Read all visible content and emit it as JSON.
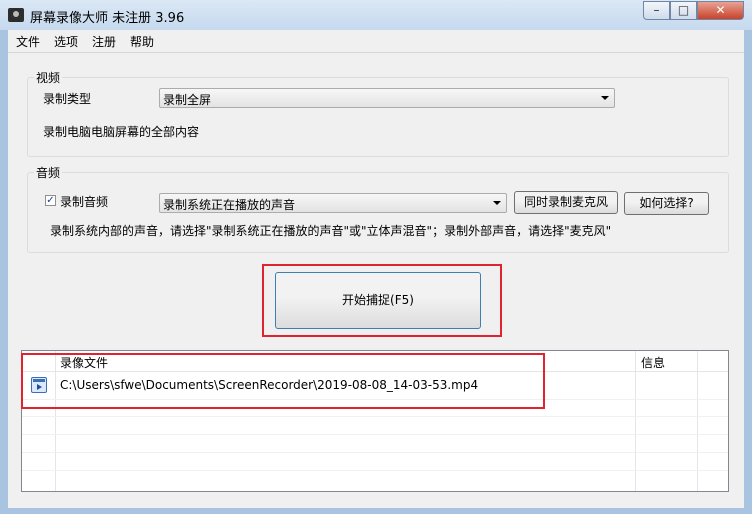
{
  "window": {
    "title": "屏幕录像大师 未注册 3.96"
  },
  "menu": [
    "文件",
    "选项",
    "注册",
    "帮助"
  ],
  "video": {
    "group_title": "视频",
    "record_type_label": "录制类型",
    "record_type_value": "录制全屏",
    "description": "录制电脑电脑屏幕的全部内容"
  },
  "audio": {
    "group_title": "音频",
    "record_audio_label": "录制音频",
    "record_audio_checked": true,
    "source_value": "录制系统正在播放的声音",
    "mic_button": "同时录制麦克风",
    "help_button": "如何选择?",
    "hint": "录制系统内部的声音，请选择\"录制系统正在播放的声音\"或\"立体声混音\"；录制外部声音，请选择\"麦克风\""
  },
  "start_button": "开始捕捉(F5)",
  "file_list": {
    "columns": [
      "录像文件",
      "信息"
    ],
    "rows": [
      {
        "file": "C:\\Users\\sfwe\\Documents\\ScreenRecorder\\2019-08-08_14-03-53.mp4",
        "info": ""
      }
    ]
  },
  "colors": {
    "highlight": "#e0242f",
    "window_frame": "#a9c4e0",
    "client_bg": "#f0f0f0"
  }
}
